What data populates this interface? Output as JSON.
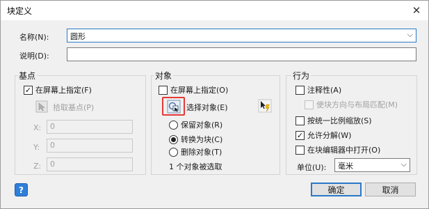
{
  "window": {
    "title": "块定义",
    "close_glyph": "✕"
  },
  "name": {
    "label": "名称(N):",
    "value": "圆形"
  },
  "description": {
    "label": "说明(D):",
    "value": ""
  },
  "basepoint": {
    "title": "基点",
    "specify_on_screen": {
      "label": "在屏幕上指定(F)",
      "checked": true
    },
    "pick_label": "拾取基点(P)",
    "x": {
      "label": "X:",
      "value": "0"
    },
    "y": {
      "label": "Y:",
      "value": "0"
    },
    "z": {
      "label": "Z:",
      "value": "0"
    }
  },
  "objects": {
    "title": "对象",
    "specify_on_screen": {
      "label": "在屏幕上指定(O)",
      "checked": false
    },
    "select_label": "选择对象(E)",
    "retain_label": "保留对象(R)",
    "convert_label": "转换为块(C)",
    "delete_label": "删除对象(T)",
    "selected_radio": "convert",
    "status": "1 个对象被选取"
  },
  "behavior": {
    "title": "行为",
    "annotative": {
      "label": "注释性(A)",
      "checked": false
    },
    "match_orientation": {
      "label": "使块方向与布局匹配(M)",
      "checked": false
    },
    "scale_uniformly": {
      "label": "按统一比例缩放(S)",
      "checked": false
    },
    "allow_exploding": {
      "label": "允许分解(W)",
      "checked": true
    },
    "open_in_editor": {
      "label": "在块编辑器中打开(O)",
      "checked": false
    },
    "unit_label": "单位(U):",
    "unit_value": "毫米"
  },
  "footer": {
    "ok_label": "确定",
    "cancel_label": "取消",
    "help_glyph": "?"
  },
  "colors": {
    "accent": "#2a78c8",
    "highlight": "#e53935",
    "help": "#2f7fd9"
  }
}
